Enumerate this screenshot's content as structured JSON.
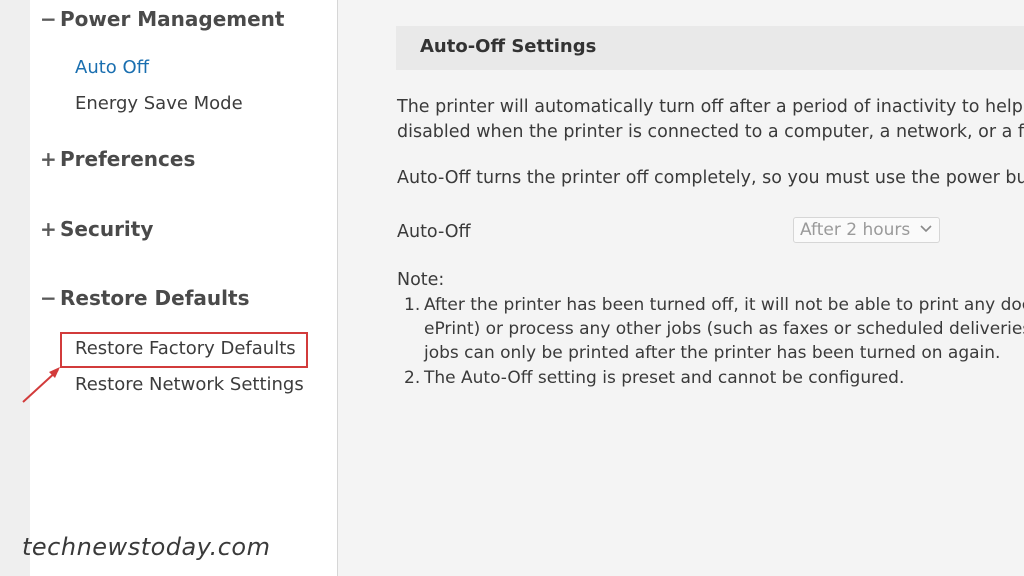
{
  "sidebar": {
    "sections": [
      {
        "sign": "−",
        "label": "Power Management"
      },
      {
        "sign": "+",
        "label": "Preferences"
      },
      {
        "sign": "+",
        "label": "Security"
      },
      {
        "sign": "−",
        "label": "Restore Defaults"
      }
    ],
    "power_items": [
      "Auto Off",
      "Energy Save Mode"
    ],
    "restore_items": [
      "Restore Factory Defaults",
      "Restore Network Settings"
    ]
  },
  "watermark": "technewstoday.com",
  "main": {
    "header": "Auto-Off Settings",
    "para1_line1": "The printer will automatically turn off after a period of inactivity to help re",
    "para1_line2": "disabled when the printer is connected to a computer, a network, or a fax",
    "para2": "Auto-Off turns the printer off completely, so you must use the power butt",
    "setting_label": "Auto-Off",
    "setting_value": "After 2 hours",
    "note_label": "Note:",
    "notes": [
      {
        "num": "1.",
        "lines": [
          "After the printer has been turned off, it will not be able to print any doc",
          "ePrint) or process any other jobs (such as faxes or scheduled deliveries",
          "jobs can only be printed after the printer has been turned on again."
        ]
      },
      {
        "num": "2.",
        "lines": [
          "The Auto-Off setting is preset and cannot be configured."
        ]
      }
    ]
  },
  "colors": {
    "active_link": "#1a6fb0",
    "highlight": "#d23b3b"
  }
}
